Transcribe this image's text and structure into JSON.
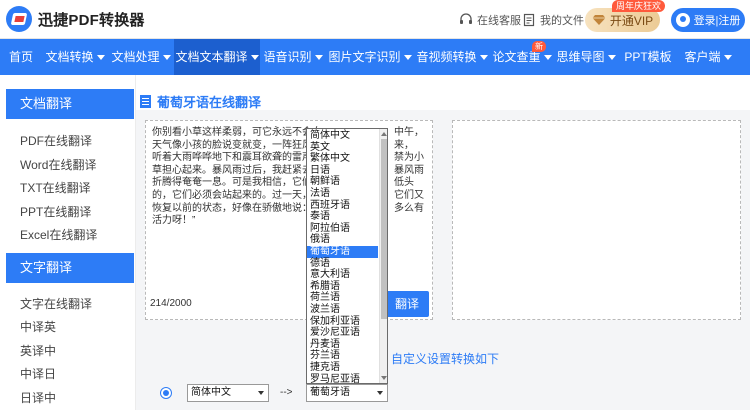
{
  "header": {
    "logo_text": "迅捷PDF转换器",
    "service_label": "在线客服",
    "files_label": "我的文件",
    "vip_label": "开通VIP",
    "vip_badge": "周年庆狂欢",
    "login_label": "登录|注册"
  },
  "nav": {
    "items": [
      {
        "label": "首页",
        "caret": false
      },
      {
        "label": "文档转换",
        "caret": true
      },
      {
        "label": "文档处理",
        "caret": true
      },
      {
        "label": "文档文本翻译",
        "caret": true
      },
      {
        "label": "语音识别",
        "caret": true
      },
      {
        "label": "图片文字识别",
        "caret": true
      },
      {
        "label": "音视频转换",
        "caret": true
      },
      {
        "label": "论文查重",
        "caret": true
      },
      {
        "label": "思维导图",
        "caret": true
      },
      {
        "label": "PPT模板",
        "caret": false
      },
      {
        "label": "客户端",
        "caret": true
      }
    ],
    "new_badge": "新",
    "active_index": 3
  },
  "sidebar": {
    "section1_title": "文档翻译",
    "section1_items": [
      "PDF在线翻译",
      "Word在线翻译",
      "TXT在线翻译",
      "PPT在线翻译",
      "Excel在线翻译"
    ],
    "section2_title": "文字翻译",
    "section2_items": [
      "文字在线翻译",
      "中译英",
      "英译中",
      "中译日",
      "日译中"
    ]
  },
  "main": {
    "title": "葡萄牙语在线翻译",
    "source_lines": [
      "你别看小草这样柔弱，可它永远不会向",
      "天气像小孩的脸说变就变，一阵狂风过",
      "听着大雨哗哗地下和震耳欲聋的雷声“",
      "草担心起来。暴风雨过后，我赶紧去看",
      "折腾得奄奄一息。可是我相信，它们必",
      "的，它们必须会站起来的。过一天，小",
      "恢复以前的状态，好像在骄傲地说：“",
      "活力呀！”"
    ],
    "source_lines_right": [
      "中午，",
      "来，",
      "禁为小",
      "暴风雨",
      "低头",
      "它们又",
      "多么有",
      ""
    ],
    "char_count": "214/2000",
    "translate_button": "翻译",
    "settings_title": "自定义设置转换如下",
    "from_language": "简体中文",
    "arrow_text": "-->",
    "to_language": "葡萄牙语"
  },
  "dropdown": {
    "options": [
      "简体中文",
      "英文",
      "繁体中文",
      "日语",
      "朝鲜语",
      "法语",
      "西班牙语",
      "泰语",
      "阿拉伯语",
      "俄语",
      "葡萄牙语",
      "德语",
      "意大利语",
      "希腊语",
      "荷兰语",
      "波兰语",
      "保加利亚语",
      "爱沙尼亚语",
      "丹麦语",
      "芬兰语",
      "捷克语",
      "罗马尼亚语"
    ],
    "selected": "葡萄牙语"
  },
  "colors": {
    "accent": "#2d7cf6",
    "nav_active": "#1c5fcf",
    "badge": "#ff5a3c"
  }
}
